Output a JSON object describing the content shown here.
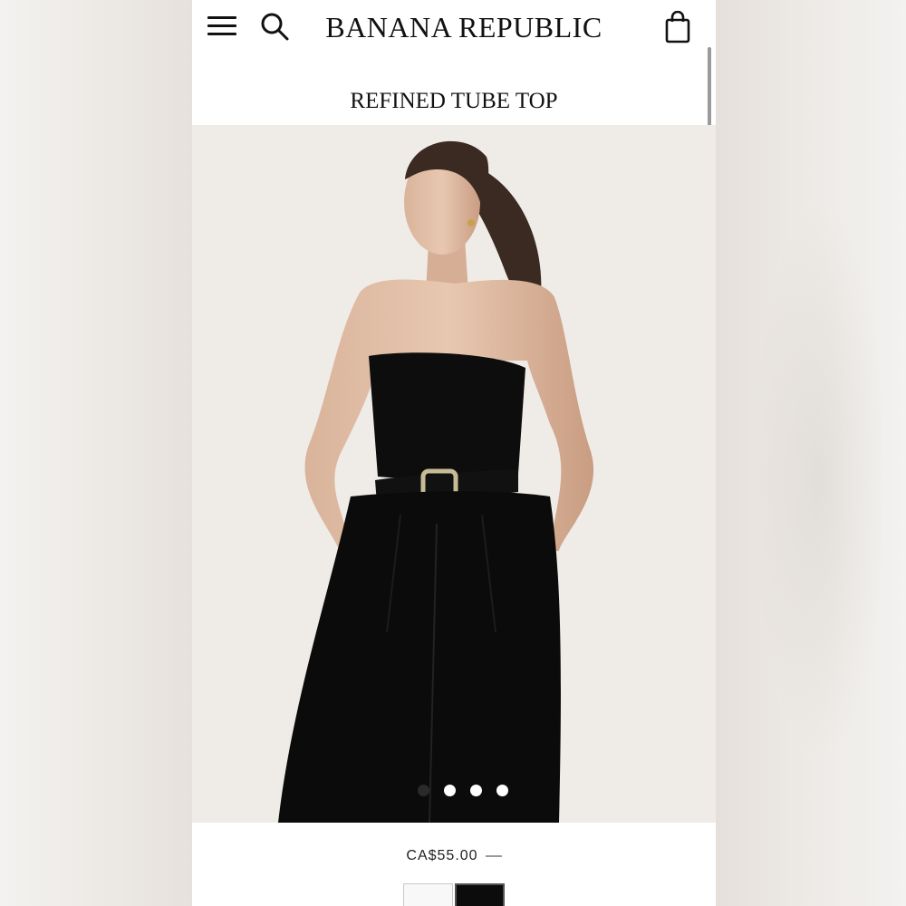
{
  "header": {
    "brand": "BANANA REPUBLIC",
    "menu_icon": "hamburger-menu-icon",
    "search_icon": "search-icon",
    "bag_icon": "shopping-bag-icon"
  },
  "product": {
    "title": "REFINED TUBE TOP",
    "price": "CA$55.00",
    "image_count": 4,
    "active_image": 1,
    "swatches": [
      {
        "color": "#f8f8f8",
        "selected": false
      },
      {
        "color": "#0c0c0c",
        "selected": true
      }
    ]
  },
  "colors": {
    "background": "#ffffff",
    "image_bg": "#efece8",
    "text": "#111111"
  }
}
